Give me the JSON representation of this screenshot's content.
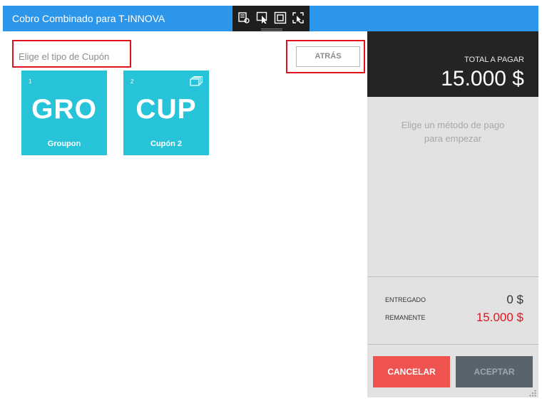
{
  "window": {
    "title": "Cobro Combinado para T-INNOVA"
  },
  "left": {
    "type_label": "Elige el tipo de  Cupón",
    "back_label": "ATRÁS",
    "tiles": [
      {
        "number": "1",
        "abbr": "GRO",
        "name": "Groupon",
        "has_stack_icon": false
      },
      {
        "number": "2",
        "abbr": "CUP",
        "name": "Cupón 2",
        "has_stack_icon": true
      }
    ]
  },
  "right": {
    "total_label": "TOTAL A PAGAR",
    "total_amount": "15.000 $",
    "hint_line1": "Elige un método de pago",
    "hint_line2": "para empezar",
    "delivered_label": "ENTREGADO",
    "delivered_value": "0 $",
    "remaining_label": "REMANENTE",
    "remaining_value": "15.000 $",
    "cancel_label": "CANCELAR",
    "accept_label": "ACEPTAR"
  },
  "colors": {
    "titlebar": "#2b96ea",
    "tile": "#27c4d9",
    "cancel": "#ef5350",
    "accept": "#58636b",
    "remaining": "#e1141e",
    "highlight": "#e0121b"
  },
  "icons": [
    "select-element-icon",
    "pointer-select-icon",
    "frame-icon",
    "refresh-select-icon",
    "stack-icon",
    "resize-grip-icon"
  ]
}
